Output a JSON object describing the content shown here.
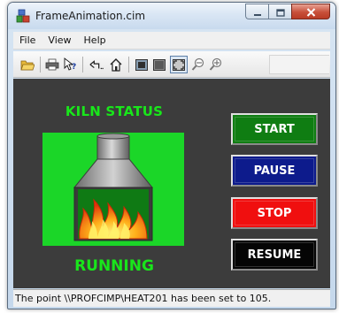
{
  "window": {
    "title": "FrameAnimation.cim",
    "app_icon": "cimplicity-app-icon",
    "caption_buttons": [
      "minimize-icon",
      "maximize-icon",
      "close-icon"
    ]
  },
  "menu": {
    "items": [
      {
        "label": "File"
      },
      {
        "label": "View"
      },
      {
        "label": "Help"
      }
    ]
  },
  "toolbar": {
    "icons": [
      "open-folder-icon",
      "print-icon",
      "context-help-icon",
      "back-icon",
      "home-icon",
      "view-small-icon",
      "view-medium-icon",
      "view-fit-icon",
      "zoom-out-icon",
      "zoom-in-icon"
    ],
    "pressed": "view-fit-icon"
  },
  "kiln": {
    "title": "KILN STATUS",
    "status": "RUNNING",
    "colors": {
      "text": "#19e61b",
      "panel": "#1bd628",
      "canvas": "#3c3c3c"
    }
  },
  "controls": {
    "start": {
      "label": "START",
      "color": "#0f7d12"
    },
    "pause": {
      "label": "PAUSE",
      "color": "#0d1b8c"
    },
    "stop": {
      "label": "STOP",
      "color": "#f00f0f"
    },
    "resume": {
      "label": "RESUME",
      "color": "#050505"
    }
  },
  "statusbar": {
    "message": "The point \\\\PROFCIMP\\HEAT201 has been set to 105."
  }
}
